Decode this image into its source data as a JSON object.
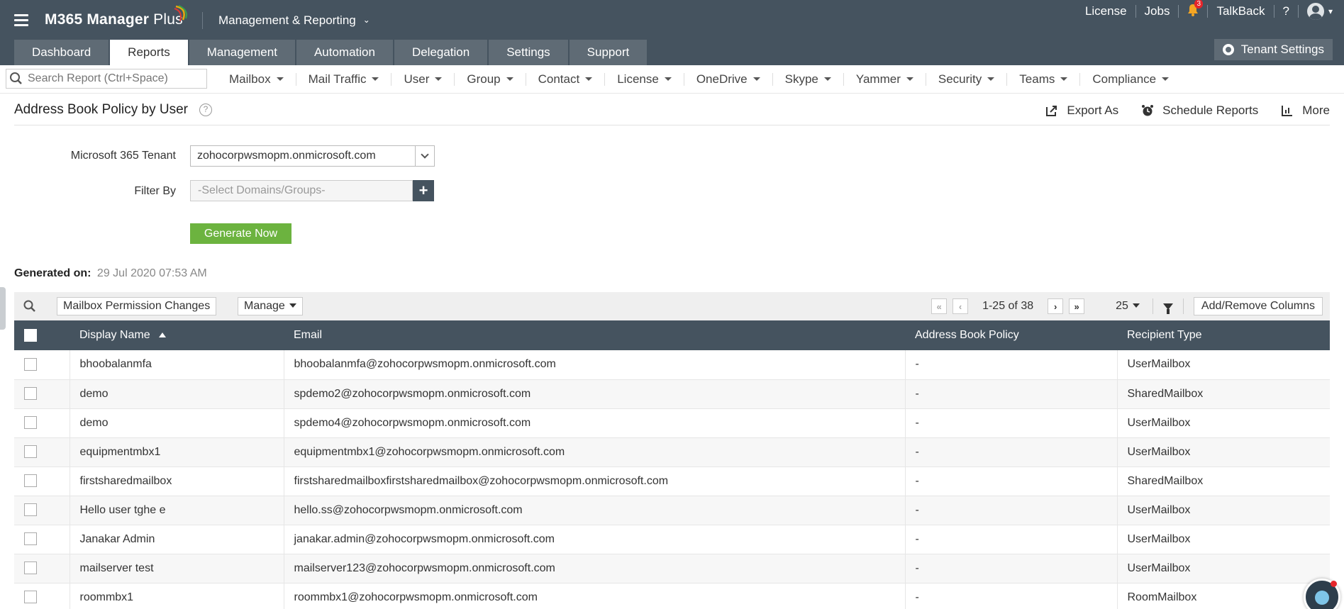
{
  "app": {
    "brand": "M365 Manager",
    "brand_plus": " Plus",
    "module": "Management & Reporting"
  },
  "top_links": {
    "license": "License",
    "jobs": "Jobs",
    "notifications_count": "3",
    "talkback": "TalkBack",
    "help": "?"
  },
  "tabs": [
    "Dashboard",
    "Reports",
    "Management",
    "Automation",
    "Delegation",
    "Settings",
    "Support"
  ],
  "active_tab": "Reports",
  "tenant_settings": "Tenant Settings",
  "search": {
    "placeholder": "Search Report (Ctrl+Space)"
  },
  "menu": [
    "Mailbox",
    "Mail Traffic",
    "User",
    "Group",
    "Contact",
    "License",
    "OneDrive",
    "Skype",
    "Yammer",
    "Security",
    "Teams",
    "Compliance"
  ],
  "page": {
    "title": "Address Book Policy by User",
    "help_icon": "?",
    "actions": {
      "export": "Export As",
      "schedule": "Schedule Reports",
      "more": "More"
    }
  },
  "form": {
    "tenant_label": "Microsoft 365 Tenant",
    "tenant_value": "zohocorpwsmopm.onmicrosoft.com",
    "filter_label": "Filter By",
    "filter_placeholder": "-Select Domains/Groups-",
    "add": "+",
    "generate": "Generate Now"
  },
  "generated": {
    "label": "Generated on:",
    "value": "29 Jul 2020 07:53 AM"
  },
  "toolbar": {
    "view": "Mailbox Permission Changes",
    "manage": "Manage",
    "range": "1-25 of 38",
    "page_size": "25",
    "add_remove": "Add/Remove Columns"
  },
  "table": {
    "columns": [
      "Display Name",
      "Email",
      "Address Book Policy",
      "Recipient Type"
    ],
    "rows": [
      [
        "bhoobalanmfa",
        "bhoobalanmfa@zohocorpwsmopm.onmicrosoft.com",
        "-",
        "UserMailbox"
      ],
      [
        "demo",
        "spdemo2@zohocorpwsmopm.onmicrosoft.com",
        "-",
        "SharedMailbox"
      ],
      [
        "demo",
        "spdemo4@zohocorpwsmopm.onmicrosoft.com",
        "-",
        "UserMailbox"
      ],
      [
        "equipmentmbx1",
        "equipmentmbx1@zohocorpwsmopm.onmicrosoft.com",
        "-",
        "UserMailbox"
      ],
      [
        "firstsharedmailbox",
        "firstsharedmailboxfirstsharedmailbox@zohocorpwsmopm.onmicrosoft.com",
        "-",
        "SharedMailbox"
      ],
      [
        "Hello user tghe e",
        "hello.ss@zohocorpwsmopm.onmicrosoft.com",
        "-",
        "UserMailbox"
      ],
      [
        "Janakar Admin",
        "janakar.admin@zohocorpwsmopm.onmicrosoft.com",
        "-",
        "UserMailbox"
      ],
      [
        "mailserver test",
        "mailserver123@zohocorpwsmopm.onmicrosoft.com",
        "-",
        "UserMailbox"
      ],
      [
        "roommbx1",
        "roommbx1@zohocorpwsmopm.onmicrosoft.com",
        "-",
        "RoomMailbox"
      ]
    ]
  },
  "colors": {
    "header_bg": "#45535f",
    "tab_bg": "#5f6b75",
    "accent_green": "#6cb33f",
    "badge_red": "#e5252a"
  }
}
